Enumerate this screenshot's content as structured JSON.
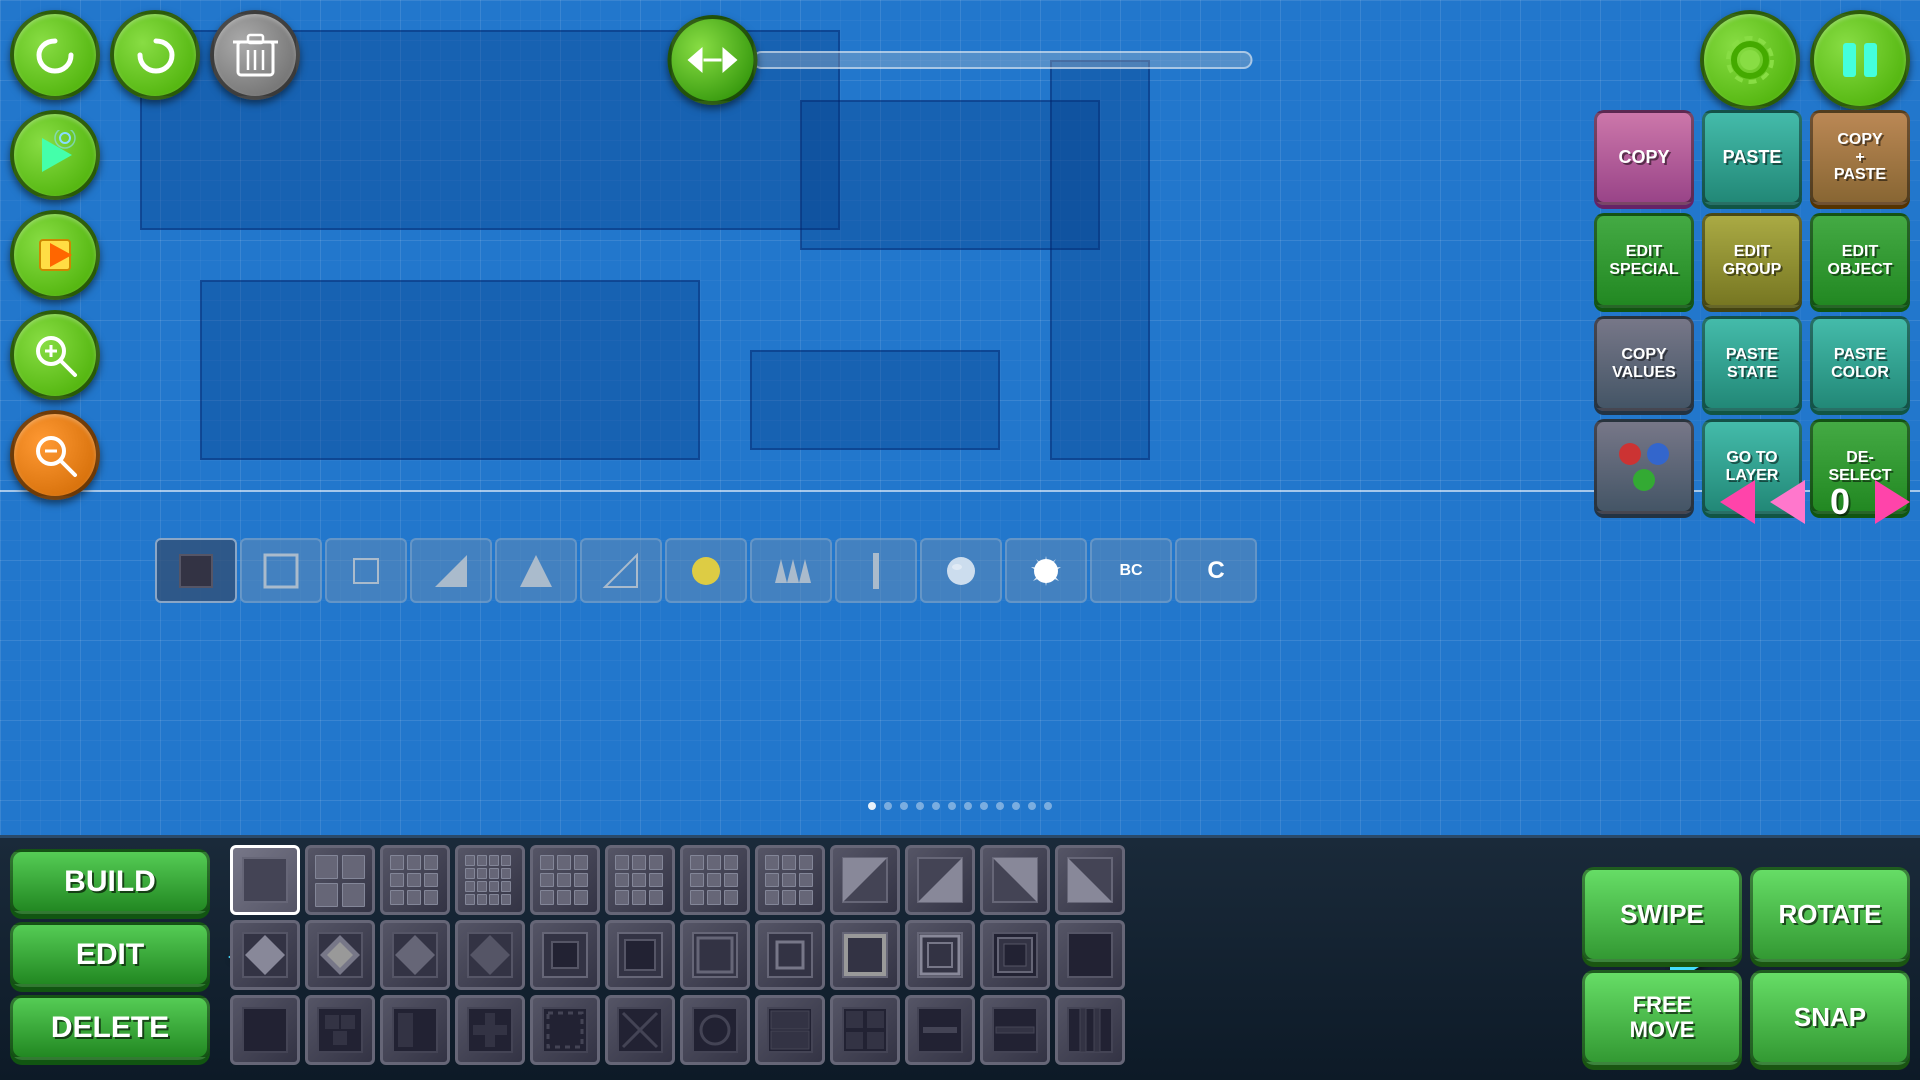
{
  "background": {
    "gridColor": "#2277cc"
  },
  "topLeft": {
    "undoLabel": "↩",
    "redoLabel": "↪",
    "deleteLabel": "🗑"
  },
  "topCenter": {
    "sliderIcon": "↔"
  },
  "topRight": {
    "settingsIcon": "⚙",
    "pauseIcon": "⏸"
  },
  "rightPanel": {
    "buttons": [
      {
        "label": "COPY",
        "style": "btn-pink",
        "name": "copy-button"
      },
      {
        "label": "PASTE",
        "style": "btn-teal",
        "name": "paste-button"
      },
      {
        "label": "COPY\n+\nPASTE",
        "style": "btn-brown",
        "name": "copy-paste-button"
      },
      {
        "label": "EDIT\nSPECIAL",
        "style": "btn-green-dark",
        "name": "edit-special-button"
      },
      {
        "label": "EDIT\nGROUP",
        "style": "btn-olive",
        "name": "edit-group-button"
      },
      {
        "label": "EDIT\nOBJECT",
        "style": "btn-green-dark",
        "name": "edit-object-button"
      },
      {
        "label": "COPY\nVALUES",
        "style": "btn-gray-dark",
        "name": "copy-values-button"
      },
      {
        "label": "PASTE\nSTATE",
        "style": "btn-teal",
        "name": "paste-state-button"
      },
      {
        "label": "PASTE\nCOLOR",
        "style": "btn-teal",
        "name": "paste-color-button"
      },
      {
        "label": "",
        "style": "btn-gray-dark",
        "name": "color-picker-button"
      },
      {
        "label": "GO TO\nLAYER",
        "style": "btn-teal",
        "name": "go-to-layer-button"
      },
      {
        "label": "DE-\nSELECT",
        "style": "btn-green-dark",
        "name": "deselect-button"
      }
    ]
  },
  "layerNav": {
    "leftArrow": "◄",
    "rightArrow": "►",
    "layerNumber": "0"
  },
  "modeButtons": {
    "build": "BUILD",
    "edit": "EDIT",
    "delete": "DELETE"
  },
  "actionButtons": {
    "swipe": "SWIPE",
    "rotate": "ROTATE",
    "freeMove": "FREE\nMOVE",
    "snap": "SNAP"
  },
  "dots": {
    "total": 12,
    "activeIndex": 0
  }
}
